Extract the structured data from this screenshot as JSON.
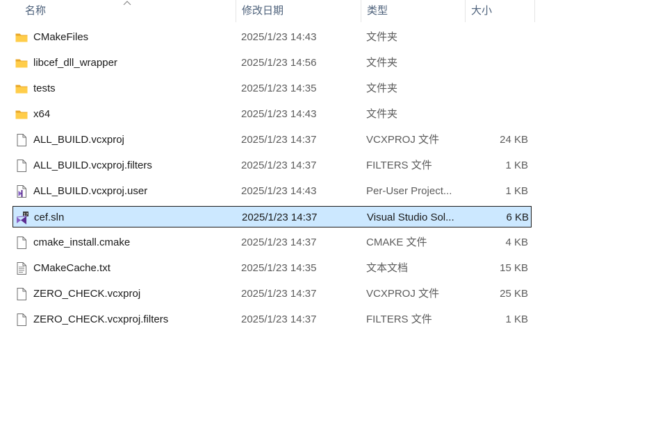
{
  "header": {
    "name": "名称",
    "date": "修改日期",
    "type": "类型",
    "size": "大小"
  },
  "files": [
    {
      "name": "CMakeFiles",
      "date": "2025/1/23 14:43",
      "type": "文件夹",
      "size": "",
      "icon": "folder-icon"
    },
    {
      "name": "libcef_dll_wrapper",
      "date": "2025/1/23 14:56",
      "type": "文件夹",
      "size": "",
      "icon": "folder-icon"
    },
    {
      "name": "tests",
      "date": "2025/1/23 14:35",
      "type": "文件夹",
      "size": "",
      "icon": "folder-icon"
    },
    {
      "name": "x64",
      "date": "2025/1/23 14:43",
      "type": "文件夹",
      "size": "",
      "icon": "folder-icon"
    },
    {
      "name": "ALL_BUILD.vcxproj",
      "date": "2025/1/23 14:37",
      "type": "VCXPROJ 文件",
      "size": "24 KB",
      "icon": "file-icon"
    },
    {
      "name": "ALL_BUILD.vcxproj.filters",
      "date": "2025/1/23 14:37",
      "type": "FILTERS 文件",
      "size": "1 KB",
      "icon": "file-icon"
    },
    {
      "name": "ALL_BUILD.vcxproj.user",
      "date": "2025/1/23 14:43",
      "type": "Per-User Project...",
      "size": "1 KB",
      "icon": "vs-user-file-icon"
    },
    {
      "name": "cef.sln",
      "date": "2025/1/23 14:37",
      "type": "Visual Studio Sol...",
      "size": "6 KB",
      "icon": "vs-solution-icon",
      "selected": true
    },
    {
      "name": "cmake_install.cmake",
      "date": "2025/1/23 14:37",
      "type": "CMAKE 文件",
      "size": "4 KB",
      "icon": "file-icon"
    },
    {
      "name": "CMakeCache.txt",
      "date": "2025/1/23 14:35",
      "type": "文本文档",
      "size": "15 KB",
      "icon": "text-file-icon"
    },
    {
      "name": "ZERO_CHECK.vcxproj",
      "date": "2025/1/23 14:37",
      "type": "VCXPROJ 文件",
      "size": "25 KB",
      "icon": "file-icon"
    },
    {
      "name": "ZERO_CHECK.vcxproj.filters",
      "date": "2025/1/23 14:37",
      "type": "FILTERS 文件",
      "size": "1 KB",
      "icon": "file-icon"
    }
  ],
  "colors": {
    "selection": "#cce8ff",
    "folder": "#f8c94b",
    "vs_purple": "#8661c5"
  }
}
